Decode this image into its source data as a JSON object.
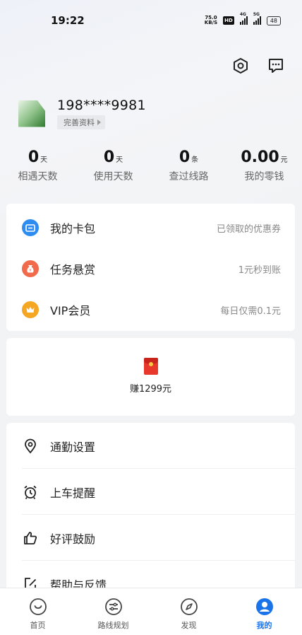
{
  "status_bar": {
    "time": "19:22",
    "net_speed_value": "75.0",
    "net_speed_unit": "KB/S",
    "hd": "HD",
    "signal1_tag": "4G",
    "signal2_tag": "5G",
    "battery": "48"
  },
  "profile": {
    "phone": "198****9981",
    "complete_label": "完善资料"
  },
  "stats": [
    {
      "value": "0",
      "unit": "天",
      "label": "相遇天数"
    },
    {
      "value": "0",
      "unit": "天",
      "label": "使用天数"
    },
    {
      "value": "0",
      "unit": "条",
      "label": "查过线路"
    },
    {
      "value": "0.00",
      "unit": "元",
      "label": "我的零钱"
    }
  ],
  "menu": [
    {
      "label": "我的卡包",
      "hint": "已领取的优惠券",
      "icon": "wallet-icon",
      "color": "#2d8cf0"
    },
    {
      "label": "任务悬赏",
      "hint": "1元秒到账",
      "icon": "money-bag-icon",
      "color": "#f06a4b"
    },
    {
      "label": "VIP会员",
      "hint": "每日仅需0.1元",
      "icon": "crown-icon",
      "color": "#f5a623"
    }
  ],
  "promo": {
    "earn_label": "赚1299元",
    "icon": "red-envelope-icon"
  },
  "settings": [
    {
      "label": "通勤设置",
      "icon": "location-pin-icon"
    },
    {
      "label": "上车提醒",
      "icon": "alarm-clock-icon"
    },
    {
      "label": "好评鼓励",
      "icon": "thumbs-up-icon"
    },
    {
      "label": "帮助与反馈",
      "icon": "edit-icon"
    }
  ],
  "nav": [
    {
      "label": "首页",
      "icon": "home-icon"
    },
    {
      "label": "路线规划",
      "icon": "route-icon"
    },
    {
      "label": "发现",
      "icon": "compass-icon"
    },
    {
      "label": "我的",
      "icon": "profile-icon",
      "active": true
    }
  ],
  "colors": {
    "accent": "#1a73e8",
    "background": "#f2f3f5"
  }
}
